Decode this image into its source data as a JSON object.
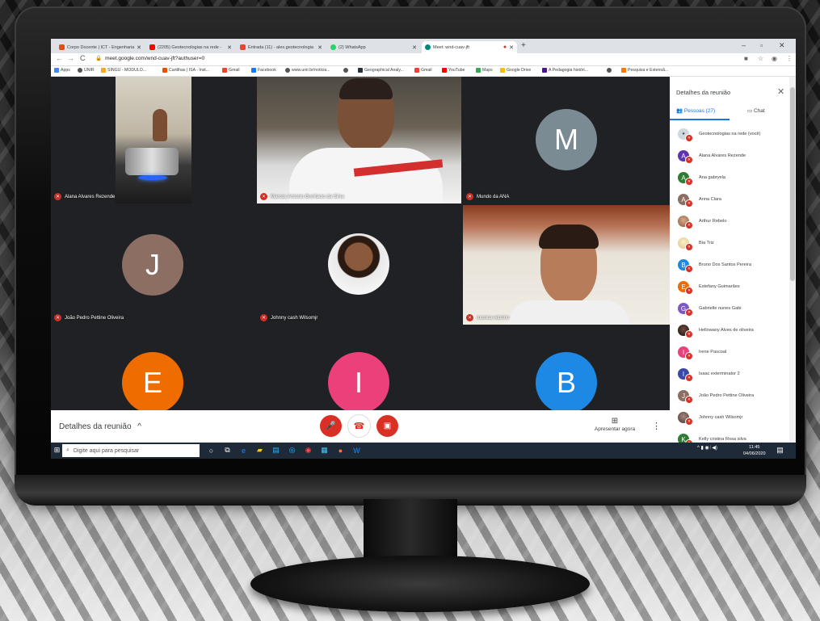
{
  "browser": {
    "tabs": [
      {
        "label": "Corpo Docente | ICT - Engenharia",
        "color": "#e64a19"
      },
      {
        "label": "(2205) Geotecnologias na rede -",
        "color": "#ff0000"
      },
      {
        "label": "Entrada (11) - alex.geotecnologia",
        "color": "#ea4335"
      },
      {
        "label": "(2) WhatsApp",
        "color": "#25d366"
      },
      {
        "label": "Meet: wnd-cuav-jft",
        "color": "#00897b"
      }
    ],
    "new_tab": "+",
    "window_controls": [
      "–",
      "▫",
      "✕"
    ],
    "url": "meet.google.com/wnd-cuav-jft?authuser=0",
    "bookmarks": [
      "Apps",
      "UNIR",
      "SINGU - MODULO...",
      "Cartilhas | ISA - Inst...",
      "Gmail",
      "Facebook",
      "www.unir.br/noticia...",
      "",
      "Geographical Analy...",
      "Gmail",
      "YouTube",
      "Maps",
      "Google Drive",
      "A Pedagogia históri...",
      "",
      "Pesquisa e Extensã..."
    ]
  },
  "meet": {
    "tiles": [
      {
        "name": "Alana Alvares Rezende",
        "type": "video"
      },
      {
        "name": "Marcos Antonio Bonifacio da Silva",
        "type": "video"
      },
      {
        "name": "Mundo da ANA",
        "type": "avatar",
        "letter": "M",
        "color": "#7a8b93"
      },
      {
        "name": "João Pedro Pettine Oliveira",
        "type": "avatar",
        "letter": "J",
        "color": "#8d6e63"
      },
      {
        "name": "Johnny cash Wilsomjr",
        "type": "photo"
      },
      {
        "name": "monica vitorino",
        "type": "video"
      },
      {
        "name": "",
        "type": "avatar",
        "letter": "E",
        "color": "#ef6c00"
      },
      {
        "name": "",
        "type": "avatar",
        "letter": "I",
        "color": "#ec407a"
      },
      {
        "name": "",
        "type": "avatar",
        "letter": "B",
        "color": "#1e88e5"
      }
    ],
    "controls": {
      "details_label": "Detalhes da reunião",
      "details_chevron": "^",
      "present_label": "Apresentar agora",
      "more_icon": "⋮"
    }
  },
  "panel": {
    "title": "Detalhes da reunião",
    "tab_people": "Pessoas (27)",
    "tab_chat": "Chat",
    "people": [
      {
        "name": "Geotecnologias na rede (você)",
        "letter": "",
        "color": "#cfd8dc"
      },
      {
        "name": "Alana Alvares Rezende",
        "letter": "A",
        "color": "#5e35b1"
      },
      {
        "name": "Ana gabryela",
        "letter": "A",
        "color": "#2e7d32"
      },
      {
        "name": "Anna Clara",
        "letter": "A",
        "color": "#8d6e63"
      },
      {
        "name": "Arthur Rebelo",
        "letter": "",
        "color": "#c98d6a"
      },
      {
        "name": "Bia Triz",
        "letter": "",
        "color": "#f1e0b0"
      },
      {
        "name": "Bruno Dos Santos Pereira",
        "letter": "B",
        "color": "#1e88e5"
      },
      {
        "name": "Estefany Guimarães",
        "letter": "E",
        "color": "#ef6c00"
      },
      {
        "name": "Gabrielle nunes Gabi",
        "letter": "G",
        "color": "#7e57c2"
      },
      {
        "name": "Hellowany Alves de oliveira",
        "letter": "",
        "color": "#3e2723"
      },
      {
        "name": "Irene Pascoal",
        "letter": "I",
        "color": "#ec407a"
      },
      {
        "name": "Isaac exterminator 2",
        "letter": "I",
        "color": "#3949ab"
      },
      {
        "name": "João Pedro Pettine Oliveira",
        "letter": "J",
        "color": "#8d6e63"
      },
      {
        "name": "Johnny cash Wilsomjr",
        "letter": "",
        "color": "#6d4c41"
      },
      {
        "name": "Kelly cristina Rosa silva",
        "letter": "K",
        "color": "#2e7d32"
      }
    ]
  },
  "taskbar": {
    "search_placeholder": "Digite aqui para pesquisar",
    "time": "11:45",
    "date": "04/06/2020"
  }
}
